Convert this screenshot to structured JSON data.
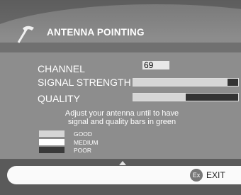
{
  "title": "ANTENNA POINTING",
  "channel": {
    "label": "CHANNEL",
    "value": "69"
  },
  "signal_strength": {
    "label": "SIGNAL STRENGTH",
    "level": 0.9
  },
  "quality": {
    "label": "QUALITY",
    "level": 0.5
  },
  "hint": {
    "line1": "Adjust your antenna until to have",
    "line2": "signal and quality bars in green"
  },
  "legend": [
    {
      "label": "GOOD",
      "color": "#d6d6d6"
    },
    {
      "label": "MEDIUM",
      "color": "#ffffff"
    },
    {
      "label": "POOR",
      "color": "#3a3a3a"
    }
  ],
  "footer": {
    "ex_label": "Ex",
    "exit_label": "EXIT"
  },
  "icons": {
    "title_icon": "antenna-tool-icon"
  }
}
